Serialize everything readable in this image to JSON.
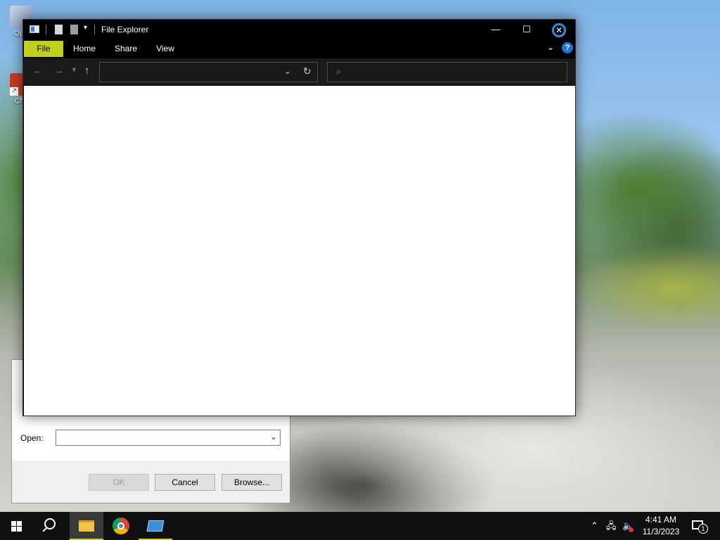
{
  "desktop": {
    "icons": [
      {
        "label": "Ope"
      },
      {
        "label": "Chil"
      }
    ]
  },
  "run_dialog": {
    "open_label": "Open:",
    "open_value": "",
    "ok_label": "OK",
    "cancel_label": "Cancel",
    "browse_label": "Browse..."
  },
  "explorer": {
    "title": "File Explorer",
    "tabs": [
      "File",
      "Home",
      "Share",
      "View"
    ],
    "address_value": "",
    "search_placeholder": "",
    "help_label": "?"
  },
  "taskbar": {
    "apps": [
      "file-explorer",
      "chrome",
      "run"
    ],
    "clock_time": "4:41 AM",
    "clock_date": "11/3/2023",
    "notification_count": "1"
  },
  "colors": {
    "accent": "#c2cf1d",
    "explorer_chrome": "#000000",
    "taskbar": "#101010",
    "help_blue": "#1e73d2"
  },
  "icons": {
    "back": "arrow-left-icon",
    "forward": "arrow-right-icon",
    "up": "arrow-up-icon",
    "refresh": "refresh-icon",
    "search": "search-icon"
  }
}
